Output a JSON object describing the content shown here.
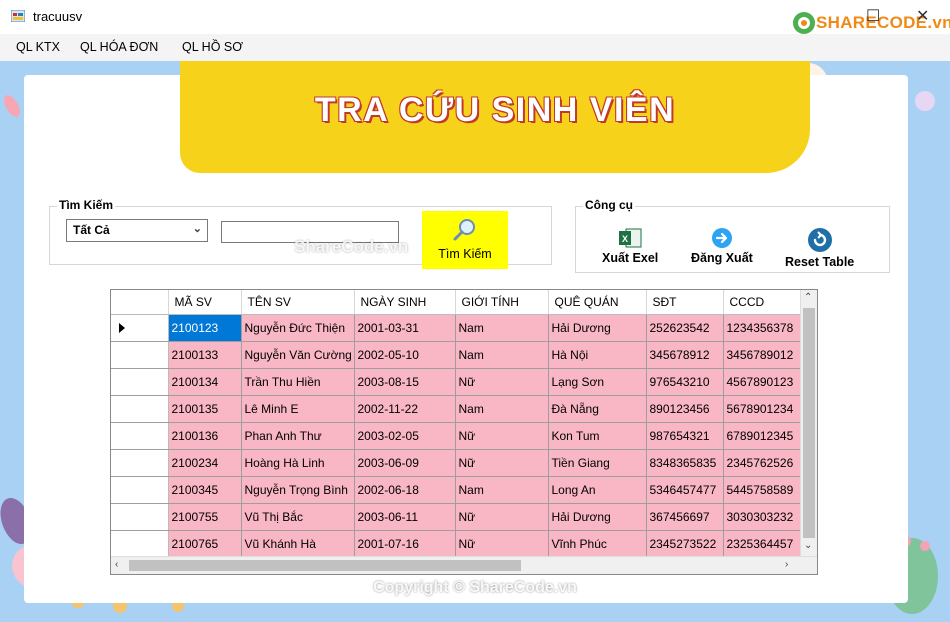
{
  "window": {
    "title": "tracuusv",
    "brand": "SHARECODE.vn"
  },
  "menu": [
    {
      "label": "QL KTX"
    },
    {
      "label": "QL HÓA ĐƠN"
    },
    {
      "label": "QL HỒ SƠ"
    }
  ],
  "banner": {
    "title": "TRA CỨU SINH VIÊN"
  },
  "search": {
    "group_label": "Tìm Kiếm",
    "filter_value": "Tất Cả",
    "input_value": "",
    "button_label": "Tìm Kiếm"
  },
  "tools": {
    "group_label": "Công cụ",
    "export_label": "Xuất Exel",
    "logout_label": "Đăng Xuất",
    "reset_label": "Reset Table"
  },
  "grid": {
    "columns": [
      "MÃ SV",
      "TÊN SV",
      "NGÀY SINH",
      "GIỚI TÍNH",
      "QUÊ QUÁN",
      "SĐT",
      "CCCD"
    ],
    "rows": [
      [
        "2100123",
        "Nguyễn Đức Thiện",
        "2001-03-31",
        "Nam",
        "Hải Dương",
        "252623542",
        "1234356378"
      ],
      [
        "2100133",
        "Nguyễn Văn Cường",
        "2002-05-10",
        "Nam",
        "Hà Nội",
        "345678912",
        "3456789012"
      ],
      [
        "2100134",
        "Trần Thu Hiền",
        "2003-08-15",
        "Nữ",
        "Lạng Sơn",
        "976543210",
        "4567890123"
      ],
      [
        "2100135",
        "Lê Minh E",
        "2002-11-22",
        "Nam",
        "Đà Nẵng",
        "890123456",
        "5678901234"
      ],
      [
        "2100136",
        "Phan Anh Thư",
        "2003-02-05",
        "Nữ",
        "Kon Tum",
        "987654321",
        "6789012345"
      ],
      [
        "2100234",
        "Hoàng Hà Linh",
        "2003-06-09",
        "Nữ",
        "Tiền Giang",
        "8348365835",
        "2345762526"
      ],
      [
        "2100345",
        "Nguyễn Trọng Bình",
        "2002-06-18",
        "Nam",
        "Long An",
        "5346457477",
        "5445758589"
      ],
      [
        "2100755",
        "Vũ Thị Bắc",
        "2003-06-11",
        "Nữ",
        "Hải Dương",
        "367456697",
        "3030303232"
      ],
      [
        "2100765",
        "Vũ Khánh Hà",
        "2001-07-16",
        "Nữ",
        "Vĩnh Phúc",
        "2345273522",
        "2325364457"
      ]
    ]
  },
  "watermark": {
    "center": "ShareCode.vn",
    "copyright": "Copyright © ShareCode.vn"
  },
  "colors": {
    "banner": "#f6d21a",
    "row": "#f9b6c4",
    "selected": "#0078d7",
    "search_button": "#ffff00",
    "background": "#a9d1f3"
  }
}
